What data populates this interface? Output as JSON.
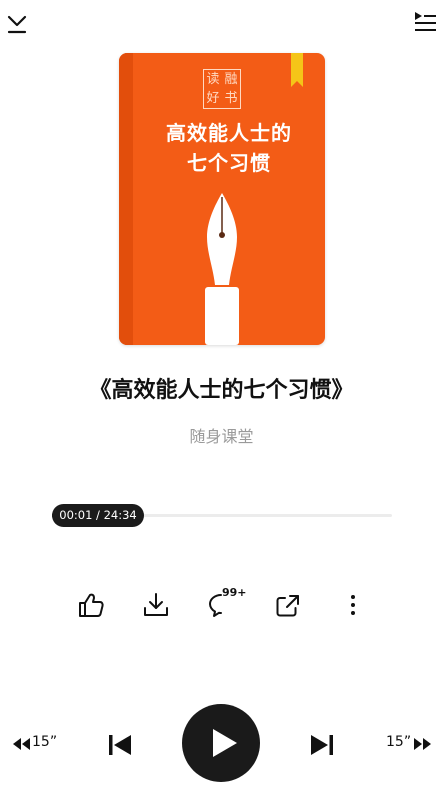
{
  "header": {
    "collapse_icon": "chevron-down-icon",
    "playlist_icon": "playlist-icon"
  },
  "cover": {
    "background_color": "#f35c16",
    "badge_chars": [
      "读",
      "融",
      "好",
      "书"
    ],
    "title_line1": "高效能人士的",
    "title_line2": "七个习惯"
  },
  "book": {
    "title": "《高效能人士的七个习惯》",
    "author": "随身课堂"
  },
  "player": {
    "time_display": "00:01 / 24:34",
    "progress_fraction": 0.0007,
    "comment_count": "99+",
    "rewind_label": "15”",
    "forward_label": "15”"
  },
  "actions": [
    {
      "name": "like-icon"
    },
    {
      "name": "download-icon"
    },
    {
      "name": "comment-icon"
    },
    {
      "name": "share-icon"
    },
    {
      "name": "more-icon"
    }
  ]
}
